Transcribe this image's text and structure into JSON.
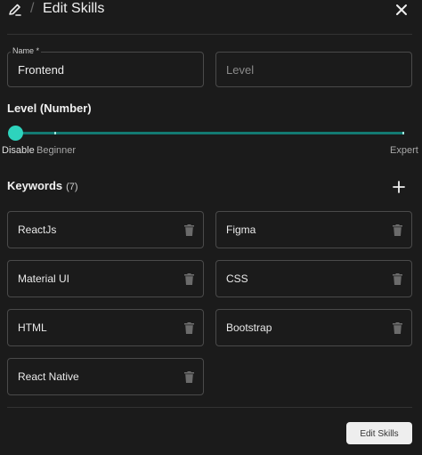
{
  "header": {
    "breadcrumb_sep": "/",
    "title": "Edit Skills"
  },
  "form": {
    "name_label": "Name *",
    "name_value": "Frontend",
    "level_placeholder": "Level"
  },
  "slider": {
    "title": "Level (Number)",
    "value": 0,
    "marks": [
      "Disable",
      "Beginner",
      "Expert"
    ],
    "accent": "#2ed3bd",
    "track_color": "#137a72"
  },
  "keywords": {
    "title": "Keywords",
    "count": "(7)",
    "items": [
      "ReactJs",
      "Figma",
      "Material UI",
      "CSS",
      "HTML",
      "Bootstrap",
      "React Native"
    ]
  },
  "footer": {
    "submit_label": "Edit Skills"
  },
  "icons": {
    "edit": "edit-pen-icon",
    "close": "close-icon",
    "add": "plus-icon",
    "delete": "trash-icon"
  },
  "colors": {
    "background": "#1b1b1b",
    "border": "#4a4a4a",
    "button_bg": "#eeeeee"
  }
}
